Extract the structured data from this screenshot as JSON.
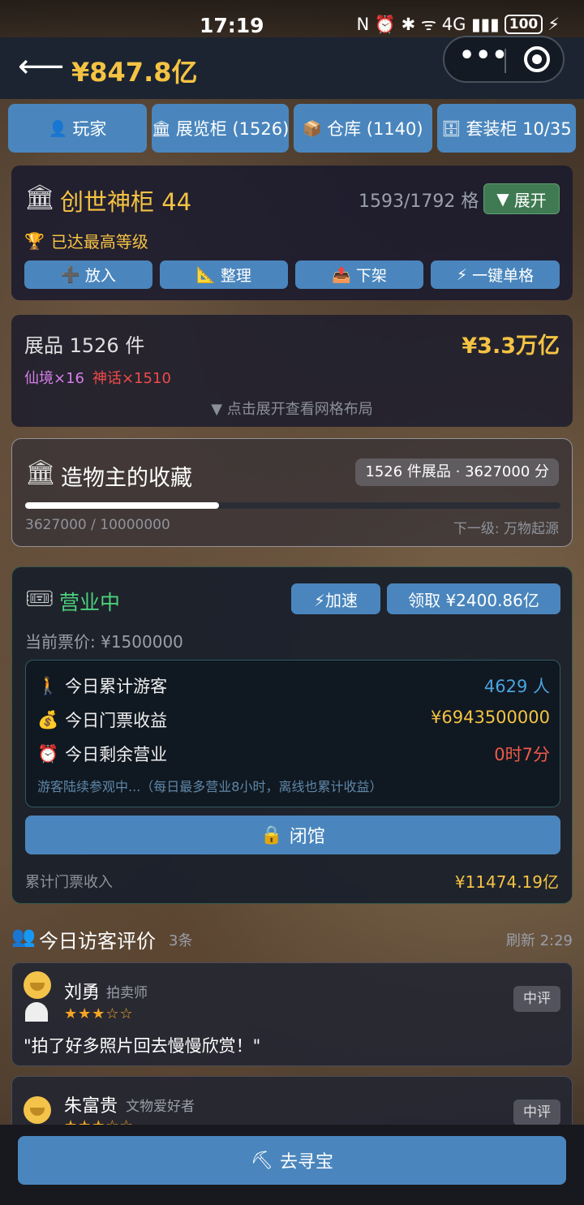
{
  "status_bar": {
    "time": "17:19",
    "icons": "N ⏰ ✱ ᯤ 4G ▮▮▮",
    "battery": "100"
  },
  "header": {
    "balance": "¥847.8亿"
  },
  "tabs": [
    {
      "icon": "👤",
      "label": "玩家"
    },
    {
      "icon": "🏛",
      "label": "展览柜 (1526)"
    },
    {
      "icon": "📦",
      "label": "仓库 (1140)"
    },
    {
      "icon": "🗄",
      "label": "套装柜 10/35"
    }
  ],
  "cabinet": {
    "icon": "🏛",
    "title": "创世神柜 44",
    "slots": "1593/1792 格",
    "expand_label": "展开",
    "max_level_icon": "🏆",
    "max_level": "已达最高等级",
    "actions": [
      {
        "icon": "➕",
        "label": "放入"
      },
      {
        "icon": "📐",
        "label": "整理"
      },
      {
        "icon": "📤",
        "label": "下架"
      },
      {
        "icon": "⚡",
        "label": "一键单格"
      }
    ]
  },
  "exhibits": {
    "count": "展品 1526 件",
    "value": "¥3.3万亿",
    "xianjing": "仙境×16",
    "shenhua": "神话×1510",
    "hint": "▼ 点击展开查看网格布局"
  },
  "collection": {
    "icon": "🏛",
    "title": "造物主的收藏",
    "badge": "1526 件展品 · 3627000 分",
    "progress_current": 3627000,
    "progress_max": 10000000,
    "progress_text": "3627000 / 10000000",
    "next_level": "下一级: 万物起源"
  },
  "business": {
    "icon": "🎟",
    "status": "营业中",
    "speed_label": "⚡加速",
    "claim_label": "领取 ¥2400.86亿",
    "ticket_price": "当前票价: ¥1500000",
    "stats": [
      {
        "icon": "🚶",
        "label": "今日累计游客",
        "value": "4629 人",
        "color": "#4aa3df"
      },
      {
        "icon": "💰",
        "label": "今日门票收益",
        "value": "¥6943500000",
        "color": "#f5c343"
      },
      {
        "icon": "⏰",
        "label": "今日剩余营业",
        "value": "0时7分",
        "color": "#f05a4a"
      }
    ],
    "note": "游客陆续参观中...（每日最多营业8小时，离线也累计收益）",
    "close_icon": "🔒",
    "close_label": "闭馆",
    "cumulative_label": "累计门票收入",
    "cumulative_value": "¥11474.19亿"
  },
  "reviews": {
    "icon": "👥",
    "title": "今日访客评价",
    "count": "3条",
    "refresh": "刷新 2:29",
    "items": [
      {
        "name": "刘勇",
        "role": "拍卖师",
        "stars": "★★★☆☆",
        "rating": 3,
        "tag": "中评",
        "text": "\"拍了好多照片回去慢慢欣赏！\""
      },
      {
        "name": "朱富贵",
        "role": "文物爱好者",
        "stars": "★★★☆☆",
        "rating": 3,
        "tag": "中评",
        "text": ""
      }
    ]
  },
  "bottom": {
    "icon": "⛏",
    "label": "去寻宝"
  }
}
